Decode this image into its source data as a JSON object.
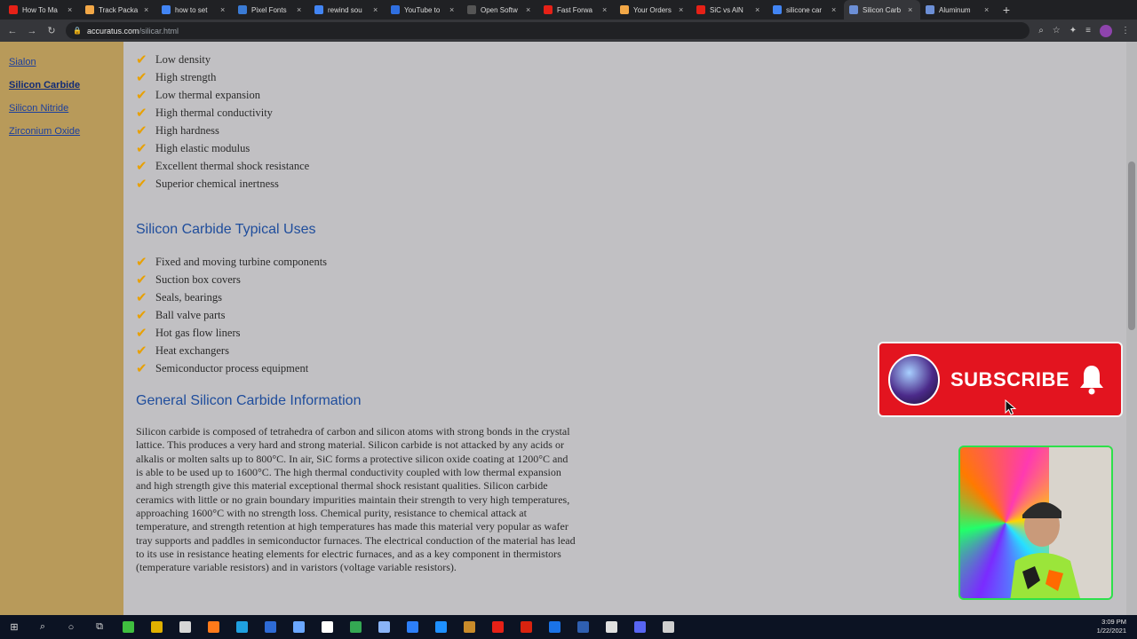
{
  "browser": {
    "tabs": [
      {
        "label": "How To Ma",
        "color": "#e62117",
        "active": false
      },
      {
        "label": "Track Packa",
        "color": "#f3a847",
        "active": false
      },
      {
        "label": "how to set",
        "color": "#4285f4",
        "active": false
      },
      {
        "label": "Pixel Fonts",
        "color": "#3a7bd5",
        "active": false
      },
      {
        "label": "rewind sou",
        "color": "#4285f4",
        "active": false
      },
      {
        "label": "YouTube to",
        "color": "#2f6fe0",
        "active": false
      },
      {
        "label": "Open Softw",
        "color": "#555555",
        "active": false
      },
      {
        "label": "Fast Forwa",
        "color": "#e62117",
        "active": false
      },
      {
        "label": "Your Orders",
        "color": "#f3a847",
        "active": false
      },
      {
        "label": "SiC vs AlN",
        "color": "#e62117",
        "active": false
      },
      {
        "label": "silicone car",
        "color": "#4285f4",
        "active": false
      },
      {
        "label": "Silicon Carb",
        "color": "#6c8fd6",
        "active": true
      },
      {
        "label": "Aluminum",
        "color": "#6c8fd6",
        "active": false
      }
    ],
    "new_tab": "+",
    "close_glyph": "×",
    "url_domain": "accuratus.com",
    "url_path": "/silicar.html"
  },
  "sidebar": {
    "items": [
      {
        "label": "Sialon",
        "active": false
      },
      {
        "label": "Silicon Carbide",
        "active": true
      },
      {
        "label": "Silicon Nitride",
        "active": false
      },
      {
        "label": "Zirconium Oxide",
        "active": false
      }
    ]
  },
  "content": {
    "properties": [
      "Low density",
      "High strength",
      "Low thermal expansion",
      "High thermal conductivity",
      "High hardness",
      "High elastic modulus",
      "Excellent thermal shock resistance",
      "Superior chemical inertness"
    ],
    "uses_heading": "Silicon Carbide Typical Uses",
    "uses": [
      "Fixed and moving turbine components",
      "Suction box covers",
      "Seals, bearings",
      "Ball valve parts",
      "Hot gas flow liners",
      "Heat exchangers",
      "Semiconductor process equipment"
    ],
    "info_heading": "General Silicon Carbide Information",
    "info_paragraph": "Silicon carbide is composed of tetrahedra of carbon and silicon atoms with strong bonds in the crystal lattice. This produces a very hard and strong material. Silicon carbide is not attacked by any acids or alkalis or molten salts up to 800°C. In air, SiC forms a protective silicon oxide coating at 1200°C and is able to be used up to 1600°C. The high thermal conductivity coupled with low thermal expansion and high strength give this material exceptional thermal shock resistant qualities. Silicon carbide ceramics with little or no grain boundary impurities maintain their strength to very high temperatures, approaching 1600°C with no strength loss. Chemical purity, resistance to chemical attack at temperature, and strength retention at high temperatures has made this material very popular as wafer tray supports and paddles in semiconductor furnaces. The electrical conduction of the material has lead to its use in resistance heating elements for electric furnaces, and as a key component in thermistors (temperature variable resistors) and in varistors (voltage variable resistors)."
  },
  "overlay": {
    "subscribe_label": "SUBSCRIBE"
  },
  "taskbar": {
    "time": "3:09 PM",
    "date": "1/22/2021"
  }
}
